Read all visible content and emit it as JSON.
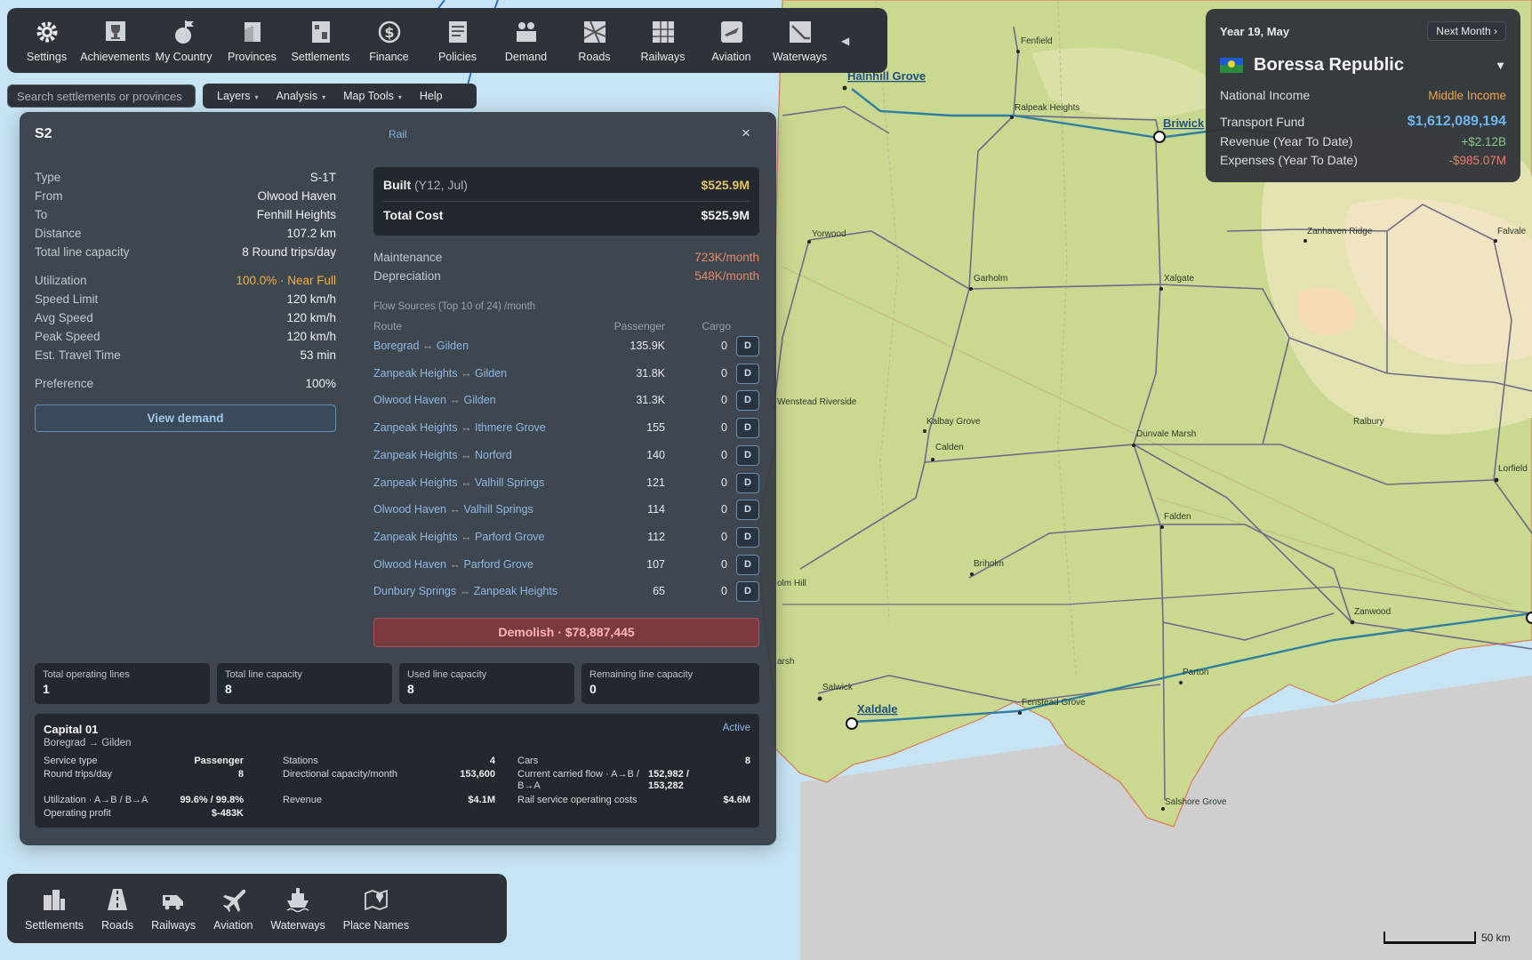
{
  "toolbar": {
    "items": [
      {
        "label": "Settings",
        "icon": "gear-icon"
      },
      {
        "label": "Achievements",
        "icon": "trophy-icon"
      },
      {
        "label": "My Country",
        "icon": "flag-icon"
      },
      {
        "label": "Provinces",
        "icon": "provinces-icon"
      },
      {
        "label": "Settlements",
        "icon": "settlements-icon"
      },
      {
        "label": "Finance",
        "icon": "dollar-icon"
      },
      {
        "label": "Policies",
        "icon": "policies-icon"
      },
      {
        "label": "Demand",
        "icon": "demand-icon"
      },
      {
        "label": "Roads",
        "icon": "roads-icon"
      },
      {
        "label": "Railways",
        "icon": "railways-icon"
      },
      {
        "label": "Aviation",
        "icon": "aviation-icon"
      },
      {
        "label": "Waterways",
        "icon": "waterways-icon"
      }
    ],
    "collapse": "◀"
  },
  "search": {
    "placeholder": "Search settlements or provinces"
  },
  "menubar": {
    "items": [
      "Layers",
      "Analysis",
      "Map Tools",
      "Help"
    ]
  },
  "info": {
    "date": "Year 19, May",
    "next_month": "Next Month ›",
    "country": "Boressa Republic",
    "dropdown": "▼",
    "national_income_label": "National Income",
    "national_income": "Middle Income",
    "transport_fund_label": "Transport Fund",
    "transport_fund": "$1,612,089,194",
    "revenue_label": "Revenue (Year To Date)",
    "revenue": "+$2.12B",
    "expenses_label": "Expenses (Year To Date)",
    "expenses": "-$985.07M",
    "colors": {
      "income": "#f0a44a",
      "fund": "#6db6f2",
      "revenue": "#86c98a",
      "expenses": "#e8806a"
    }
  },
  "panel": {
    "title": "S2",
    "subtitle": "Rail",
    "close": "×",
    "details": [
      {
        "k": "Type",
        "v": "S-1T"
      },
      {
        "k": "From",
        "v": "Olwood Haven"
      },
      {
        "k": "To",
        "v": "Fenhill Heights"
      },
      {
        "k": "Distance",
        "v": "107.2 km"
      },
      {
        "k": "Total line capacity",
        "v": "8 Round trips/day"
      }
    ],
    "details2": [
      {
        "k": "Utilization",
        "v": "100.0% · Near Full"
      },
      {
        "k": "Speed Limit",
        "v": "120 km/h"
      },
      {
        "k": "Avg Speed",
        "v": "120 km/h"
      },
      {
        "k": "Peak Speed",
        "v": "120 km/h"
      },
      {
        "k": "Est. Travel Time",
        "v": "53 min"
      }
    ],
    "preference": {
      "k": "Preference",
      "v": "100%"
    },
    "view_demand": "View demand",
    "built_label": "Built",
    "built_date": "(Y12, Jul)",
    "built_value": "$525.9M",
    "total_cost_label": "Total Cost",
    "total_cost_value": "$525.9M",
    "maintenance_label": "Maintenance",
    "maintenance_value": "723K/month",
    "depreciation_label": "Depreciation",
    "depreciation_value": "548K/month",
    "flow_header": "Flow Sources (Top 10 of 24)  /month",
    "flow_cols": {
      "route": "Route",
      "passenger": "Passenger",
      "cargo": "Cargo"
    },
    "flows": [
      {
        "a": "Boregrad",
        "b": "Gilden",
        "passenger": "135.9K",
        "cargo": "0"
      },
      {
        "a": "Zanpeak Heights",
        "b": "Gilden",
        "passenger": "31.8K",
        "cargo": "0"
      },
      {
        "a": "Olwood Haven",
        "b": "Gilden",
        "passenger": "31.3K",
        "cargo": "0"
      },
      {
        "a": "Zanpeak Heights",
        "b": "Ithmere Grove",
        "passenger": "155",
        "cargo": "0"
      },
      {
        "a": "Zanpeak Heights",
        "b": "Norford",
        "passenger": "140",
        "cargo": "0"
      },
      {
        "a": "Zanpeak Heights",
        "b": "Valhill Springs",
        "passenger": "121",
        "cargo": "0"
      },
      {
        "a": "Olwood Haven",
        "b": "Valhill Springs",
        "passenger": "114",
        "cargo": "0"
      },
      {
        "a": "Zanpeak Heights",
        "b": "Parford Grove",
        "passenger": "112",
        "cargo": "0"
      },
      {
        "a": "Olwood Haven",
        "b": "Parford Grove",
        "passenger": "107",
        "cargo": "0"
      },
      {
        "a": "Dunbury Springs",
        "b": "Zanpeak Heights",
        "passenger": "65",
        "cargo": "0"
      }
    ],
    "flow_arrow": "↔",
    "d_label": "D",
    "demolish": "Demolish · $78,887,445",
    "stats": [
      {
        "label": "Total operating lines",
        "value": "1"
      },
      {
        "label": "Total line capacity",
        "value": "8"
      },
      {
        "label": "Used line capacity",
        "value": "8"
      },
      {
        "label": "Remaining line capacity",
        "value": "0"
      }
    ],
    "line_card": {
      "name": "Capital 01",
      "route": "Boregrad → Gilden",
      "status": "Active",
      "service_type_label": "Service type",
      "service_type": "Passenger",
      "round_trips_label": "Round trips/day",
      "round_trips": "8",
      "utilization_label": "Utilization · A→B / B→A",
      "utilization": "99.6% / 99.8%",
      "profit_label": "Operating profit",
      "profit": "$-483K",
      "stations_label": "Stations",
      "stations": "4",
      "dir_capacity_label": "Directional capacity/month",
      "dir_capacity": "153,600",
      "revenue_label": "Revenue",
      "revenue": "$4.1M",
      "cars_label": "Cars",
      "cars": "8",
      "carried_label_1": "Current carried flow · A→B /",
      "carried_label_2": "B→A",
      "carried_1": "152,982 /",
      "carried_2": "153,282",
      "costs_label": "Rail service operating costs",
      "costs": "$4.6M"
    }
  },
  "layerbar": {
    "items": [
      {
        "label": "Settlements",
        "icon": "settlements-layer-icon"
      },
      {
        "label": "Roads",
        "icon": "roads-layer-icon"
      },
      {
        "label": "Railways",
        "icon": "train-icon"
      },
      {
        "label": "Aviation",
        "icon": "airplane-icon"
      },
      {
        "label": "Waterways",
        "icon": "ship-icon"
      },
      {
        "label": "Place Names",
        "icon": "map-pin-icon"
      }
    ]
  },
  "map": {
    "labels": {
      "fenfield": "Fenfield",
      "halnhill": "Halnhill Grove",
      "ralpeak": "Ralpeak Heights",
      "briwick": "Briwick",
      "yorwood": "Yorwood",
      "zanhaven": "Zanhaven Ridge",
      "falvale": "Falvale",
      "garholm": "Garholm",
      "xalgate": "Xalgate",
      "wenstead": "Wenstead Riverside",
      "kalbay": "Kalbay Grove",
      "calden": "Calden",
      "dunvale": "Dunvale Marsh",
      "ralbury": "Ralbury",
      "lorfield": "Lorfield",
      "falden": "Falden",
      "briholm": "Briholm",
      "olmhill": "olm Hill",
      "zanwood": "Zanwood",
      "parton": "Parton",
      "salwick": "Salwick",
      "xaldale": "Xaldale",
      "fenstead": "Fenstead Grove",
      "salshore": "Salshore Grove",
      "marsh": "arsh"
    },
    "scale_label": "50 km"
  }
}
